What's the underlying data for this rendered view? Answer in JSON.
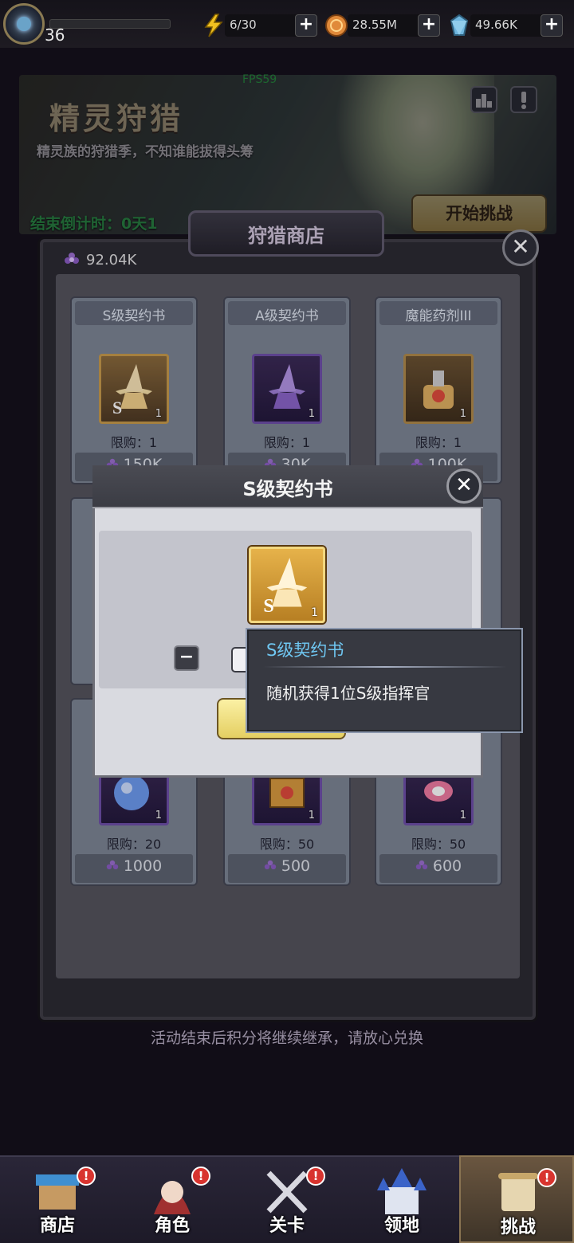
{
  "top_bar": {
    "level": "36",
    "energy": "6/30",
    "gold": "28.55M",
    "gems": "49.66K",
    "plus_label": "+"
  },
  "banner": {
    "title": "精灵狩猎",
    "subtitle": "精灵族的狩猎季，不知谁能拔得头筹",
    "fps": "FPS59",
    "countdown": "结束倒计时：0天1",
    "start_button": "开始挑战"
  },
  "shop": {
    "tab_title": "狩猎商店",
    "close_label": "✕",
    "points": "92.04K",
    "items": [
      {
        "name": "S级契约书",
        "limit": "限购：1",
        "price": "150K",
        "count": "1",
        "icon": "s-contract-icon"
      },
      {
        "name": "A级契约书",
        "limit": "限购：1",
        "price": "30K",
        "count": "1",
        "icon": "a-contract-icon"
      },
      {
        "name": "魔能药剂III",
        "limit": "限购：1",
        "price": "100K",
        "count": "1",
        "icon": "potion-icon"
      },
      {
        "name": "",
        "limit": "限购：20",
        "price": "1000",
        "count": "1",
        "icon": "blue-flask-icon"
      },
      {
        "name": "",
        "limit": "限购：50",
        "price": "500",
        "count": "1",
        "icon": "crate-icon"
      },
      {
        "name": "",
        "limit": "限购：50",
        "price": "600",
        "count": "1",
        "icon": "candy-icon"
      }
    ],
    "footer_note": "活动结束后积分将继续继承，请放心兑换"
  },
  "popup": {
    "title": "S级契约书",
    "close_label": "✕",
    "item_count": "1",
    "minus_label": "−"
  },
  "tooltip": {
    "title": "S级契约书",
    "description": "随机获得1位S级指挥官"
  },
  "bottom_nav": [
    {
      "label": "商店",
      "badge": "!",
      "active": false
    },
    {
      "label": "角色",
      "badge": "!",
      "active": false
    },
    {
      "label": "关卡",
      "badge": "!",
      "active": false
    },
    {
      "label": "领地",
      "badge": "",
      "active": false
    },
    {
      "label": "挑战",
      "badge": "!",
      "active": true
    }
  ],
  "colors": {
    "accent_gold": "#e4cf62",
    "tooltip_title": "#6fc7f2",
    "countdown_green": "#39d45d",
    "badge_red": "#d8342f"
  }
}
